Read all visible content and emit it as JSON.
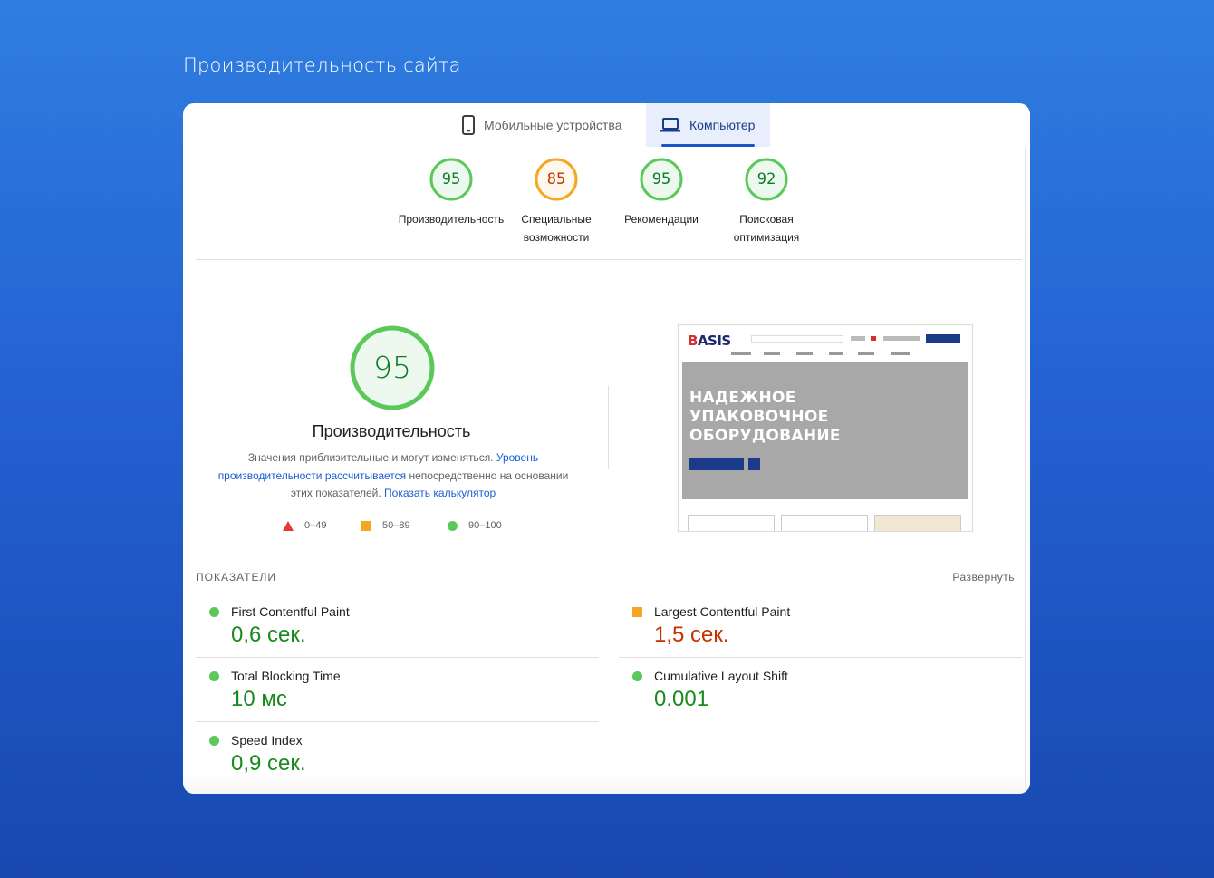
{
  "page_title": "Производительность сайта",
  "tabs": [
    {
      "label": "Мобильные устройства",
      "icon": "smartphone-icon",
      "active": false
    },
    {
      "label": "Компьютер",
      "icon": "laptop-icon",
      "active": true
    }
  ],
  "gauges": [
    {
      "score": "95",
      "label_line1": "Производительность",
      "label_line2": "",
      "color": "#0cce6b",
      "text_color": "#0d7a2b"
    },
    {
      "score": "85",
      "label_line1": "Специальные",
      "label_line2": "возможности",
      "color": "#ffa400",
      "text_color": "#c33300"
    },
    {
      "score": "95",
      "label_line1": "Рекомендации",
      "label_line2": "",
      "color": "#0cce6b",
      "text_color": "#0d7a2b"
    },
    {
      "score": "92",
      "label_line1": "Поисковая",
      "label_line2": "оптимизация",
      "color": "#0cce6b",
      "text_color": "#0d7a2b"
    }
  ],
  "main_score": {
    "score": "95",
    "title": "Производительность",
    "desc_part1": "Значения приблизительные и могут изменяться.",
    "desc_link1": "Уровень производительности рассчитывается",
    "desc_part2": "непосредственно на основании этих показателей.",
    "desc_link2": "Показать калькулятор"
  },
  "legend": [
    {
      "range": "0–49",
      "shape": "triangle",
      "color": "#e53935"
    },
    {
      "range": "50–89",
      "shape": "square",
      "color": "#f5a623"
    },
    {
      "range": "90–100",
      "shape": "circle",
      "color": "#5ac85a"
    }
  ],
  "screenshot": {
    "logo_prefix": "B",
    "logo_rest": "ASIS",
    "hero_line1": "НАДЕЖНОЕ",
    "hero_line2": "УПАКОВОЧНОЕ",
    "hero_line3": "ОБОРУДОВАНИЕ"
  },
  "metrics_header": {
    "label": "ПОКАЗАТЕЛИ",
    "expand": "Развернуть"
  },
  "metrics": [
    {
      "name": "First Contentful Paint",
      "value": "0,6 сек.",
      "status": "good"
    },
    {
      "name": "Total Blocking Time",
      "value": "10 мс",
      "status": "good"
    },
    {
      "name": "Speed Index",
      "value": "0,9 сек.",
      "status": "good"
    },
    {
      "name": "Largest Contentful Paint",
      "value": "1,5 сек.",
      "status": "average"
    },
    {
      "name": "Cumulative Layout Shift",
      "value": "0.001",
      "status": "good"
    }
  ],
  "colors": {
    "good": "#5ac85a",
    "average": "#f5a623",
    "poor": "#e53935",
    "link": "#1a5fd0"
  }
}
